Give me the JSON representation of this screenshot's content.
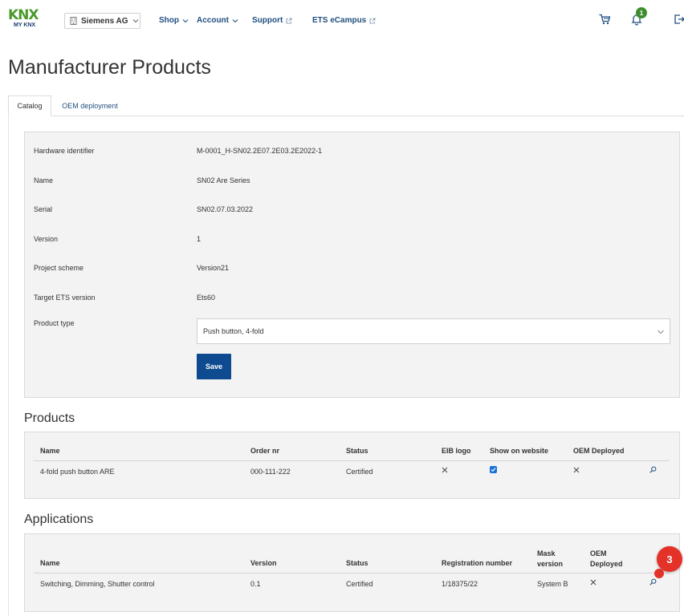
{
  "header": {
    "logo_text": "KNX",
    "logo_sub": "MY KNX",
    "organization": "Siemens AG",
    "nav": [
      {
        "label": "Shop",
        "type": "dropdown"
      },
      {
        "label": "Account",
        "type": "dropdown"
      },
      {
        "label": "Support",
        "type": "external"
      },
      {
        "label": "ETS eCampus",
        "type": "external"
      }
    ],
    "icons": [
      "cart-icon",
      "bell-icon",
      "logout-icon"
    ],
    "notification_count": "1"
  },
  "page": {
    "title": "Manufacturer Products"
  },
  "tabs": [
    {
      "label": "Catalog",
      "active": true
    },
    {
      "label": "OEM deployment",
      "active": false
    }
  ],
  "details": {
    "fields": [
      {
        "label": "Hardware identifier",
        "value": "M-0001_H-SN02.2E07.2E03.2E2022-1"
      },
      {
        "label": "Name",
        "value": "SN02 Are Series"
      },
      {
        "label": "Serial",
        "value": "SN02.07.03.2022"
      },
      {
        "label": "Version",
        "value": "1"
      },
      {
        "label": "Project scheme",
        "value": "Version21"
      },
      {
        "label": "Target ETS version",
        "value": "Ets60"
      }
    ],
    "product_type_label": "Product type",
    "product_type_value": "Push button, 4-fold",
    "save_label": "Save"
  },
  "products": {
    "title": "Products",
    "columns": [
      "Name",
      "Order nr",
      "Status",
      "EIB logo",
      "Show on website",
      "OEM Deployed"
    ],
    "rows": [
      {
        "name": "4-fold push button ARE",
        "order_nr": "000-111-222",
        "status": "Certified",
        "eib_logo": false,
        "show_on_website": true,
        "oem_deployed": false
      }
    ]
  },
  "applications": {
    "title": "Applications",
    "columns": [
      "Name",
      "Version",
      "Status",
      "Registration number",
      "Mask version",
      "OEM Deployed"
    ],
    "mask_lines": [
      "Mask",
      "version"
    ],
    "oem_lines": [
      "OEM",
      "Deployed"
    ],
    "rows": [
      {
        "name": "Switching, Dimming, Shutter control",
        "version": "0.1",
        "status": "Certified",
        "registration_number": "1/18375/22",
        "mask_version": "System B",
        "oem_deployed": false
      }
    ]
  },
  "step_marker": "3",
  "colors": {
    "primary_button": "#0d4a8f",
    "nav_link": "#1f4f7f",
    "badge": "#3e8e2e",
    "step_marker": "#e43228",
    "checkbox": "#1a73d9"
  }
}
